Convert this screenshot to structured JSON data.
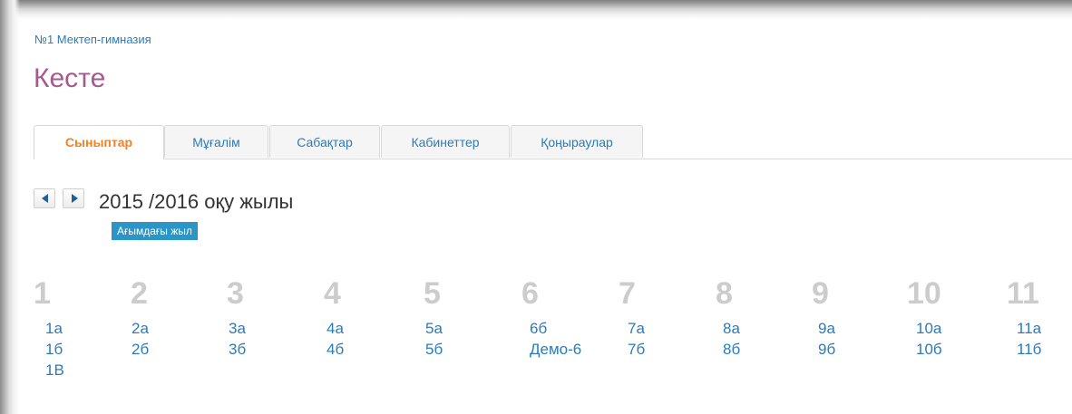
{
  "header": {
    "school_link": "№1 Мектеп-гимназия",
    "page_title": "Кесте"
  },
  "tabs": [
    {
      "label": "Сыныптар",
      "active": true
    },
    {
      "label": "Мұғалім",
      "active": false
    },
    {
      "label": "Сабақтар",
      "active": false
    },
    {
      "label": "Кабинеттер",
      "active": false
    },
    {
      "label": "Қоңыраулар",
      "active": false
    }
  ],
  "year": {
    "prev_icon": "triangle-left-icon",
    "next_icon": "triangle-right-icon",
    "label": "2015 /2016 оқу жылы",
    "badge": "Ағымдағы жыл"
  },
  "grades": [
    {
      "number": "1",
      "classes": [
        "1а",
        "1б",
        "1В"
      ]
    },
    {
      "number": "2",
      "classes": [
        "2а",
        "2б"
      ]
    },
    {
      "number": "3",
      "classes": [
        "3а",
        "3б"
      ]
    },
    {
      "number": "4",
      "classes": [
        "4а",
        "4б"
      ]
    },
    {
      "number": "5",
      "classes": [
        "5а",
        "5б"
      ]
    },
    {
      "number": "6",
      "classes": [
        "6б",
        "Демо-6"
      ]
    },
    {
      "number": "7",
      "classes": [
        "7а",
        "7б"
      ]
    },
    {
      "number": "8",
      "classes": [
        "8а",
        "8б"
      ]
    },
    {
      "number": "9",
      "classes": [
        "9а",
        "9б"
      ]
    },
    {
      "number": "10",
      "classes": [
        "10а",
        "10б"
      ]
    },
    {
      "number": "11",
      "classes": [
        "11а",
        "11б"
      ]
    }
  ],
  "colors": {
    "link": "#2b7bb9",
    "title": "#a7588f",
    "active_tab": "#f58220",
    "badge": "#2a96c8",
    "grade_number": "#cccccc"
  }
}
